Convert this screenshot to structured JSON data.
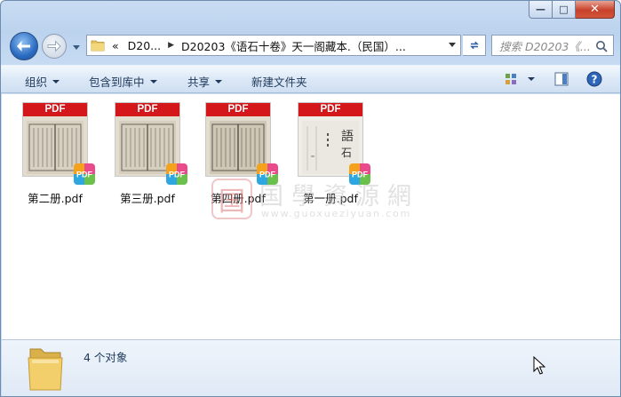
{
  "window": {
    "caption": {
      "minimize": "—",
      "maximize": "□",
      "close": "✕"
    }
  },
  "nav": {
    "breadcrumb": [
      "«",
      "D20...",
      "D20203《语石十卷》天一阁藏本.（民国）..."
    ],
    "search_placeholder": "搜索 D20203《...",
    "icons": [
      "back-arrow-icon",
      "forward-arrow-icon",
      "folder-icon",
      "refresh-icon",
      "search-icon"
    ]
  },
  "toolbar": {
    "organize": "组织",
    "include_in_library": "包含到库中",
    "share": "共享",
    "new_folder": "新建文件夹",
    "icons": [
      "view-options-icon",
      "preview-pane-icon",
      "help-icon"
    ]
  },
  "files": [
    {
      "name": "第二册.pdf",
      "thumb_label": "PDF",
      "style": "aged-scan"
    },
    {
      "name": "第三册.pdf",
      "thumb_label": "PDF",
      "style": "aged-scan"
    },
    {
      "name": "第四册.pdf",
      "thumb_label": "PDF",
      "style": "aged-scan"
    },
    {
      "name": "第一册.pdf",
      "thumb_label": "PDF",
      "style": "cover-page"
    }
  ],
  "watermark": {
    "seal": "国",
    "text": "国學資源網",
    "url": "www.guoxueziyuan.com"
  },
  "details": {
    "count": "4 个对象"
  },
  "colors": {
    "pdf_red": "#d3171b",
    "title_bar": "#bcd3ee",
    "toolbar_text": "#1e395b"
  }
}
